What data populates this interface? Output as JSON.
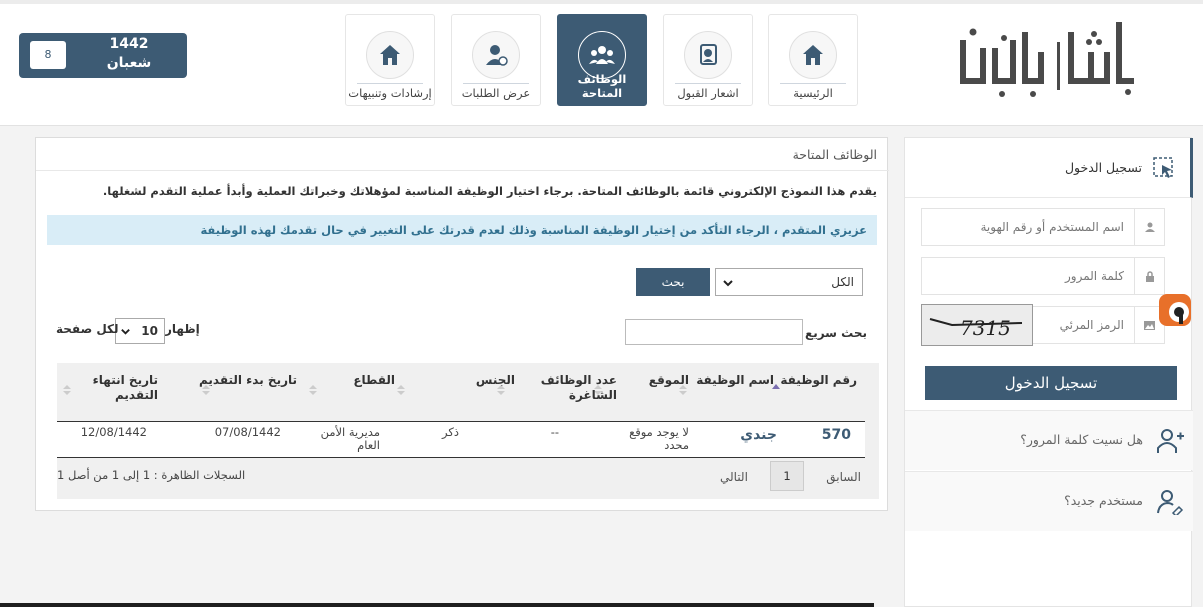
{
  "header": {
    "logo_text": "أبشر | توظيف",
    "nav": [
      {
        "label": "الرئيسية",
        "icon": "home-icon"
      },
      {
        "label": "اشعار القبول",
        "icon": "notice-icon"
      },
      {
        "label": "الوظائف المتاحة",
        "icon": "group-icon",
        "active": true
      },
      {
        "label": "عرض الطلبات",
        "icon": "user-requests-icon"
      },
      {
        "label": "إرشادات وتنبيهات",
        "icon": "home-icon"
      }
    ],
    "date": {
      "day": "8",
      "year": "1442",
      "month": "شعبان"
    }
  },
  "login": {
    "title": "تسجيل الدخول",
    "username_placeholder": "اسم المستخدم أو رقم الهوية",
    "password_placeholder": "كلمة المرور",
    "captcha_placeholder": "الرمز المرئي",
    "captcha_text": "7315",
    "button_label": "تسجيل الدخول",
    "forgot_password": "هل نسيت كلمة المرور؟",
    "new_user": "مستخدم جديد؟"
  },
  "main": {
    "title": "الوظائف المتاحة",
    "intro": "يقدم هذا النموذج الإلكتروني قائمة بالوظائف المتاحة. برجاء اختيار الوظيفة المناسبة لمؤهلاتك وخبراتك العملية وأبدأ عملية التقدم لشغلها.",
    "notice": "عزيزي المتقدم ، الرجاء التأكد من إختيار الوظيفة المناسبة وذلك لعدم قدرتك على التغيير في حال تقدمك لهذه الوظيفة",
    "filter_value": "الكل",
    "search_button": "بحث",
    "quick_search_label": "بحث سريع :",
    "show_label": "إظهار",
    "page_size": "10",
    "per_page_label": "لكل صفحة",
    "columns": {
      "job_number": "رقم الوظيفة",
      "job_name": "اسم الوظيفة",
      "location": "الموقع",
      "vacancies": "عدد الوظائف الشاغرة",
      "gender": "الجنس",
      "sector": "القطاع",
      "start_date": "تاريخ بدء التقديم",
      "end_date": "تاريخ انتهاء التقديم"
    },
    "rows": [
      {
        "job_number": "570",
        "job_name": "جندي",
        "location": "لا يوجد موقع محدد",
        "vacancies": "--",
        "gender": "ذكر",
        "sector": "مديرية الأمن العام",
        "start_date": "07/08/1442",
        "end_date": "12/08/1442"
      }
    ],
    "records_info": "السجلات الظاهرة : 1 إلى 1 من أصل 1",
    "pagination": {
      "prev": "السابق",
      "page": "1",
      "next": "التالي"
    }
  },
  "colors": {
    "primary": "#3d5b74",
    "notice_bg": "#d9edf7",
    "notice_text": "#31708f",
    "badge": "#e8702a"
  }
}
